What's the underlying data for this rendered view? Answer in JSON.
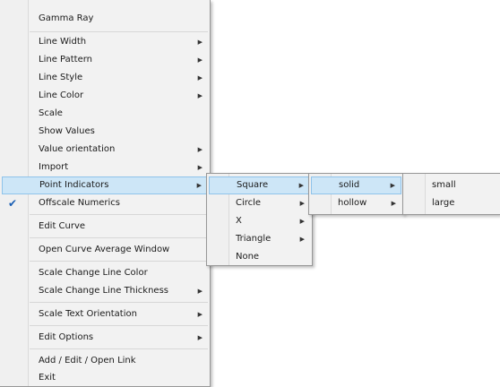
{
  "menu": {
    "items": [
      {
        "label": "Gamma Ray"
      },
      {
        "label": "Line Width",
        "submenu": true
      },
      {
        "label": "Line Pattern",
        "submenu": true
      },
      {
        "label": "Line Style",
        "submenu": true
      },
      {
        "label": "Line Color",
        "submenu": true
      },
      {
        "label": "Scale"
      },
      {
        "label": "Show Values"
      },
      {
        "label": "Value orientation",
        "submenu": true
      },
      {
        "label": "Import",
        "submenu": true
      },
      {
        "label": "Point Indicators",
        "submenu": true,
        "highlighted": true
      },
      {
        "label": "Offscale Numerics",
        "checked": true
      },
      {
        "label": "Edit Curve"
      },
      {
        "label": "Open Curve Average Window"
      },
      {
        "label": "Scale Change Line Color"
      },
      {
        "label": "Scale Change Line Thickness",
        "submenu": true
      },
      {
        "label": "Scale Text Orientation",
        "submenu": true
      },
      {
        "label": "Edit Options",
        "submenu": true
      },
      {
        "label": "Add / Edit / Open Link"
      },
      {
        "label": "Exit"
      }
    ]
  },
  "point_indicators_menu": {
    "items": [
      {
        "label": "Square",
        "submenu": true,
        "highlighted": true
      },
      {
        "label": "Circle",
        "submenu": true
      },
      {
        "label": "X",
        "submenu": true
      },
      {
        "label": "Triangle",
        "submenu": true
      },
      {
        "label": "None"
      }
    ]
  },
  "square_menu": {
    "items": [
      {
        "label": "solid",
        "submenu": true,
        "highlighted": true
      },
      {
        "label": "hollow",
        "submenu": true
      }
    ]
  },
  "solid_menu": {
    "items": [
      {
        "label": "small"
      },
      {
        "label": "large"
      }
    ]
  },
  "icons": {
    "submenu_arrow": "chevron-right-icon",
    "check": "checkmark-icon"
  },
  "colors": {
    "highlight": "#cde6f7",
    "highlight_border": "#8fc3ea",
    "menu_bg": "#f2f2f2"
  }
}
